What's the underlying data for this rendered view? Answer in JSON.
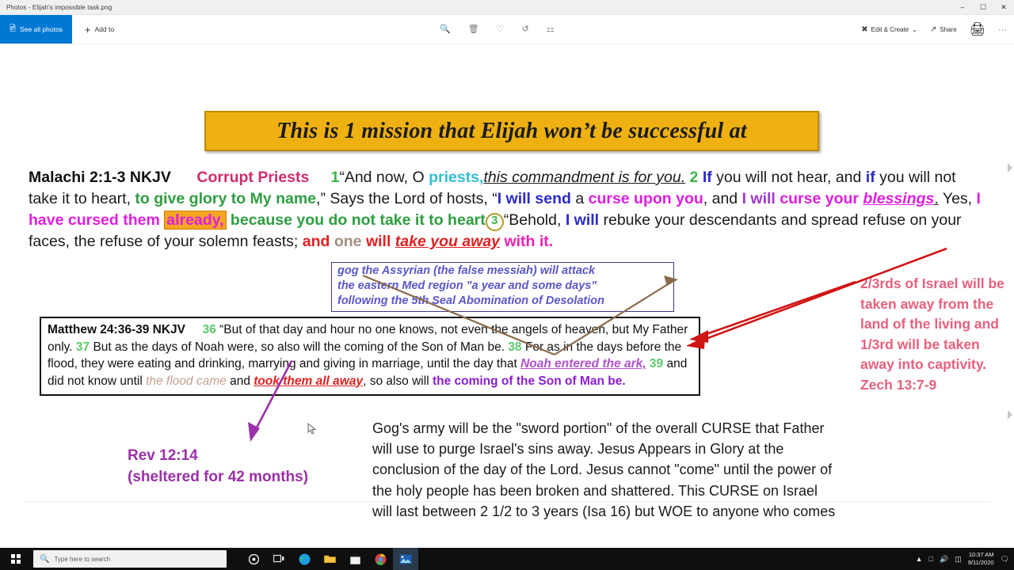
{
  "window": {
    "title": "Photos - Elijah's impossible task.png",
    "minimize_label": "–",
    "maximize_label": "☐",
    "close_label": "✕"
  },
  "toolbar": {
    "see_all_photos": "See all photos",
    "see_all_photos_icon": "photos-icon",
    "add_to": "Add to",
    "add_to_icon": "plus-icon",
    "center_icons": [
      {
        "name": "zoom-icon",
        "glyph": "⌕"
      },
      {
        "name": "delete-icon",
        "glyph": "Ὕ1"
      },
      {
        "name": "favorite-heart-icon",
        "glyph": "♡"
      },
      {
        "name": "rotate-icon",
        "glyph": "↻"
      },
      {
        "name": "crop-icon",
        "glyph": "⌗"
      }
    ],
    "edit_create": "Edit & Create",
    "edit_create_chevron": "⌄",
    "share": "Share",
    "share_icon": "share-icon",
    "print_icon": "print-icon",
    "more_label": "⋯"
  },
  "banner": {
    "text": "This is 1 mission that Elijah won’t be successful at",
    "bg_color": "#eeb111",
    "border_color": "#c08a0a",
    "text_color": "#1b1b1b"
  },
  "malachi": {
    "heading": "Malachi 2:1-3 NKJV",
    "subheading": "Corrupt Priests",
    "v1": "1",
    "t1": "“And now, O ",
    "priests": "priests,",
    "commandment": "this commandment is for you.",
    "v2": "2",
    "if1": "If",
    "t2": " you will not hear, and ",
    "if2": "if",
    "t3": " you will not take it to heart, ",
    "glory": "to give glory to My name",
    "t4": ",” Says the Lord of hosts, “",
    "send": "I will send",
    "t5": " a ",
    "curse_upon": "curse upon you",
    "t6": ", and ",
    "iwill": "I will",
    "curse_your": "curse your ",
    "blessings": "blessings",
    "period": ".",
    "yes": " Yes, ",
    "cursed_them": "I have cursed them ",
    "already": "already,",
    "because": " because you do not take it to heart",
    "v3": "3",
    "behold": "“Behold, ",
    "iwill2": "I will",
    "rebuke": " rebuke your descendants and spread refuse on your faces, the refuse of your solemn feasts; ",
    "and": "and ",
    "one": "one",
    "will": " will ",
    "takeaway": "take you away",
    "withit": "with it."
  },
  "gog_box": {
    "line1": "gog the Assyrian (the false messiah) will attack",
    "line2": "the eastern Med region \"a year and some days\"",
    "line3": "following the 5th Seal Abomination of Desolation",
    "text_color": "#5a57c9",
    "border_color": "#3b3b8f"
  },
  "matthew_box": {
    "heading": "Matthew 24:36-39 NKJV",
    "v36": "36",
    "t1": "“But of that day and hour no one knows, not even the angels of heaven, but My Father only. ",
    "v37": "37",
    "t2": " But as the days of Noah were, so also will the coming of the Son of Man be. ",
    "v38": "38",
    "t3": " For as in the days before the flood, they were eating and drinking, marrying and giving in marriage, until the day that ",
    "noah_ark": "Noah entered the ark,",
    "v39": "39",
    "t4": " and did not know until ",
    "flood_came": "the flood came",
    "t5": " and ",
    "took_away": "took them all away",
    "t6": ", so also will ",
    "son_of_man": "the coming of the Son of Man be."
  },
  "red_column": {
    "text": "2/3rds of Israel will be taken away from the land of the living and 1/3rd will be taken away into captivity.",
    "reference": "Zech 13:7-9",
    "color": "#e8607e"
  },
  "rev_note": {
    "line1": "Rev 12:14",
    "line2": "(sheltered for 42 months)",
    "color": "#9b30a8"
  },
  "gog_army": {
    "text": "Gog's army will be the \"sword portion\" of the overall CURSE that Father will use to purge Israel's sins away. Jesus Appears in Glory at the conclusion of the day of the Lord. Jesus cannot \"come\" until the power of the holy people has been broken and shattered. This CURSE on Israel will last between 2 1/2 to 3 years (Isa 16) but WOE to anyone who comes against the apple of Father's eye."
  },
  "taskbar": {
    "start_icon": "windows-start-icon",
    "search_placeholder": "Type here to search",
    "search_icon": "search-icon",
    "icons": [
      {
        "name": "cortana-icon",
        "glyph": "●"
      },
      {
        "name": "task-view-icon",
        "glyph": "▣"
      },
      {
        "name": "edge-icon",
        "glyph": "◔"
      },
      {
        "name": "file-explorer-icon",
        "glyph": "▬"
      },
      {
        "name": "store-icon",
        "glyph": "■"
      },
      {
        "name": "chrome-icon",
        "glyph": "●"
      },
      {
        "name": "photos-app-icon",
        "glyph": "▨"
      }
    ],
    "show_hidden_icon": "chevron-up-icon",
    "network_icon": "network-icon",
    "volume_icon": "volume-icon",
    "battery_icon": "battery-icon",
    "time": "10:37 AM",
    "date": "9/11/2020",
    "notifications_icon": "notifications-icon"
  }
}
